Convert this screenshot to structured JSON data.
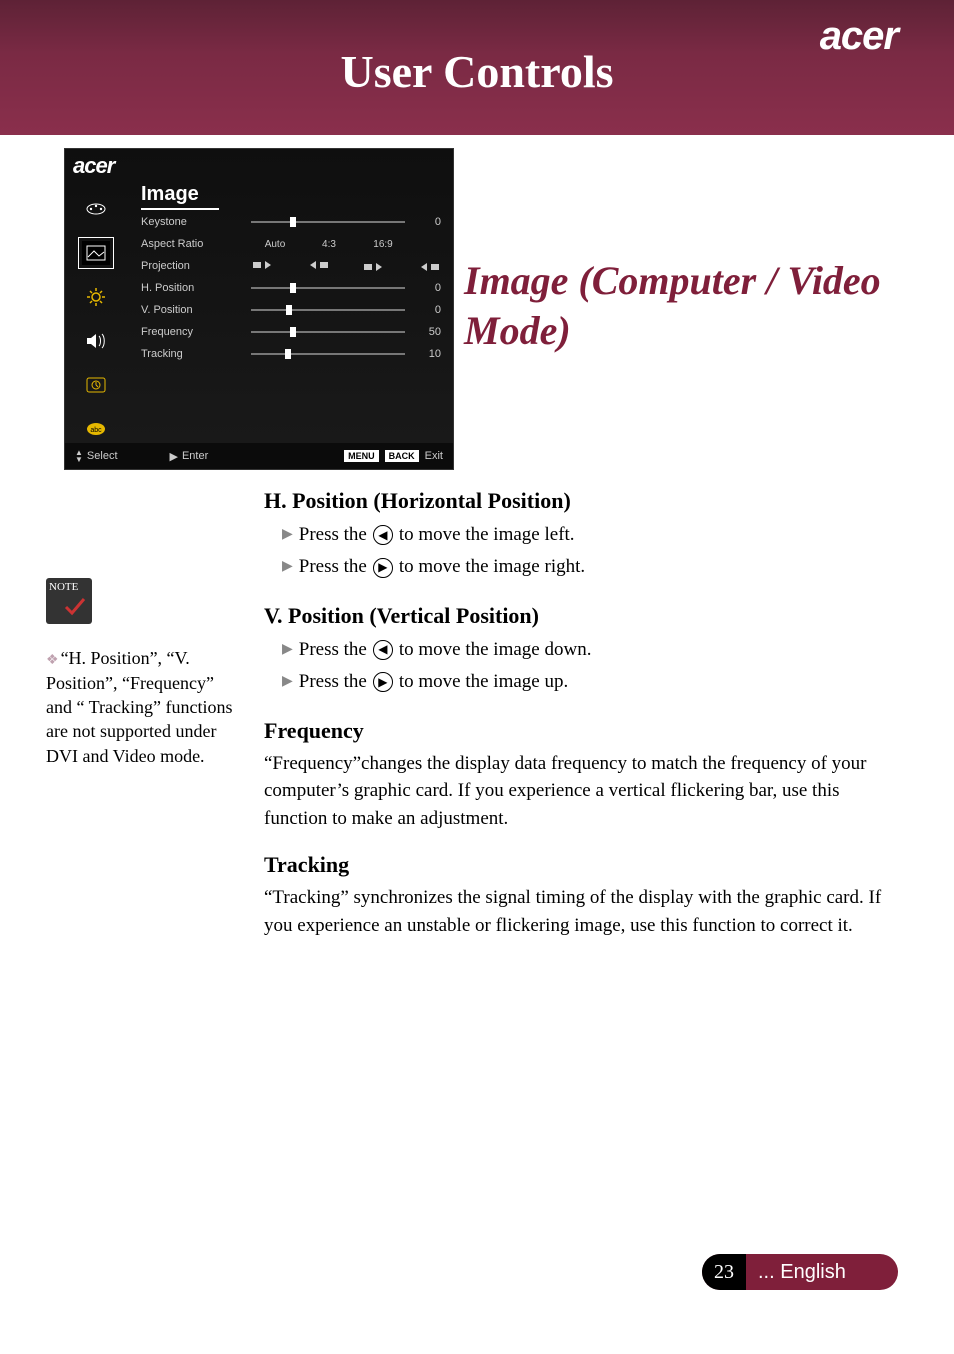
{
  "brand": "acer",
  "header_title": "User Controls",
  "section_title": "Image (Computer / Video Mode)",
  "osd": {
    "brand": "acer",
    "title": "Image",
    "rows": [
      {
        "label": "Keystone",
        "value": "0"
      },
      {
        "label": "Aspect Ratio",
        "opts": [
          "Auto",
          "4:3",
          "16:9"
        ]
      },
      {
        "label": "Projection"
      },
      {
        "label": "H. Position",
        "value": "0"
      },
      {
        "label": "V. Position",
        "value": "0"
      },
      {
        "label": "Frequency",
        "value": "50"
      },
      {
        "label": "Tracking",
        "value": "10"
      }
    ],
    "bottom": {
      "select": "Select",
      "enter": "Enter",
      "menu": "MENU",
      "back": "BACK",
      "exit": "Exit"
    }
  },
  "content": {
    "h_position": {
      "title": "H. Position (Horizontal Position)",
      "i1a": "Press the ",
      "i1b": " to move the image left.",
      "i2a": "Press the ",
      "i2b": " to move the image right."
    },
    "v_position": {
      "title": "V. Position (Vertical Position)",
      "i1a": "Press the ",
      "i1b": " to move the image down.",
      "i2a": "Press the ",
      "i2b": " to move the image up."
    },
    "frequency": {
      "title": "Frequency",
      "body": "“Frequency”changes the display data frequency to match the frequency of your computer’s graphic card. If you experience a vertical flickering bar, use this function to make an adjustment."
    },
    "tracking": {
      "title": "Tracking",
      "body": "“Tracking” synchronizes the signal timing of the display with the graphic card. If you experience an unstable or flickering image, use this function to correct it."
    }
  },
  "note": {
    "badge": "NOTE",
    "text": "“H. Position”, “V. Position”, “Frequency” and “ Tracking” functions are not supported under DVI and Video mode."
  },
  "footer": {
    "page": "23",
    "lang": "... English"
  }
}
